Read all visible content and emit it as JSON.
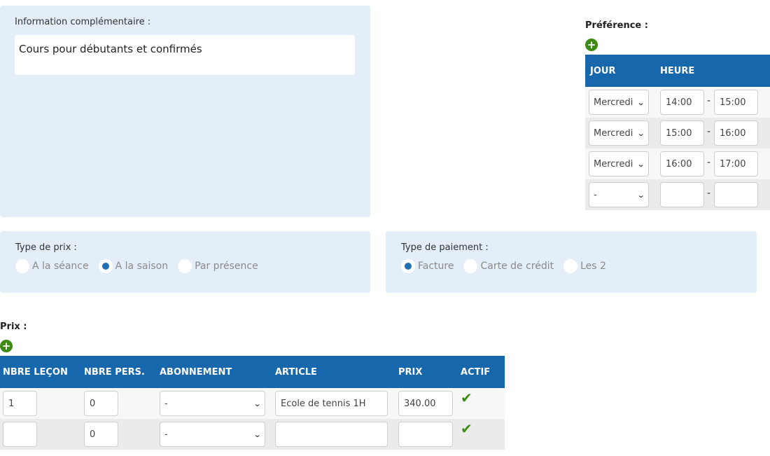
{
  "info": {
    "label": "Information complémentaire :",
    "text": "Cours pour débutants et confirmés"
  },
  "preference": {
    "title": "Préférence :",
    "add_icon": "+",
    "columns": {
      "jour": "JOUR",
      "heure": "HEURE"
    },
    "separator": "-",
    "rows": [
      {
        "day": "Mercredi",
        "start": "14:00",
        "end": "15:00"
      },
      {
        "day": "Mercredi",
        "start": "15:00",
        "end": "16:00"
      },
      {
        "day": "Mercredi",
        "start": "16:00",
        "end": "17:00"
      },
      {
        "day": "-",
        "start": "",
        "end": ""
      }
    ]
  },
  "type_prix": {
    "label": "Type de prix :",
    "options": [
      "A la séance",
      "A la saison",
      "Par présence"
    ],
    "selected": "A la saison"
  },
  "type_paiement": {
    "label": "Type de paiement :",
    "options": [
      "Facture",
      "Carte de crédit",
      "Les 2"
    ],
    "selected": "Facture"
  },
  "prix": {
    "title": "Prix :",
    "add_icon": "+",
    "columns": {
      "nbre_lecon": "NBRE LEÇON",
      "nbre_pers": "NBRE PERS.",
      "abonnement": "ABONNEMENT",
      "article": "ARTICLE",
      "prix": "PRIX",
      "actif": "ACTIF"
    },
    "rows": [
      {
        "nbre_lecon": "1",
        "nbre_pers": "0",
        "abonnement": "-",
        "article": "Ecole de tennis 1H",
        "prix": "340.00",
        "actif": true
      },
      {
        "nbre_lecon": "",
        "nbre_pers": "0",
        "abonnement": "-",
        "article": "",
        "prix": "",
        "actif": true
      }
    ]
  },
  "icons": {
    "check": "✔",
    "chevron": "⌄"
  },
  "colors": {
    "panel": "#e4eef8",
    "header": "#1767ad",
    "accent_green": "#3d8b12",
    "radio_selected": "#1f6fb4"
  }
}
